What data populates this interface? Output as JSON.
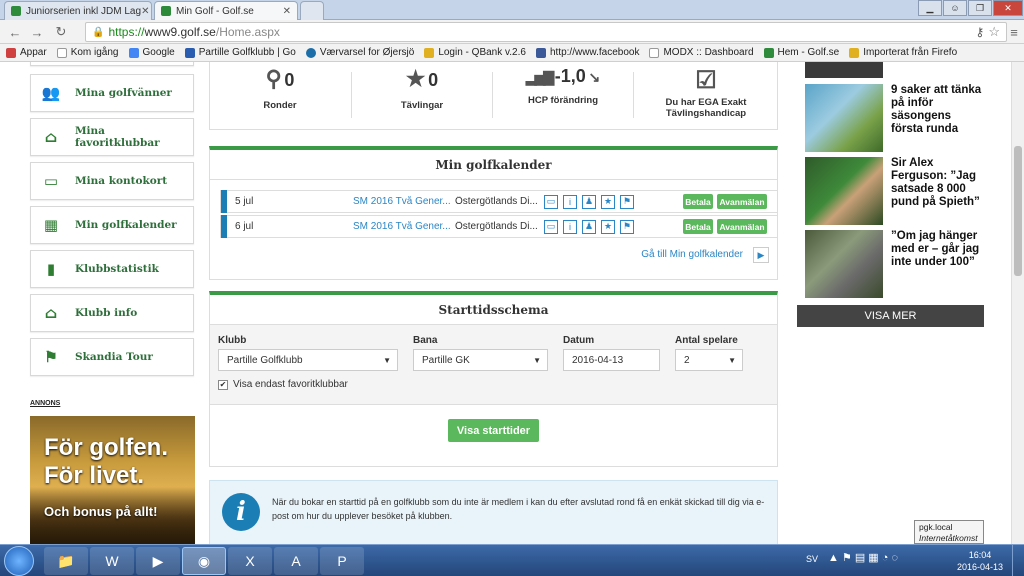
{
  "browser": {
    "tabs": [
      {
        "label": "Juniorserien inkl JDM Lag"
      },
      {
        "label": "Min Golf - Golf.se"
      }
    ],
    "url_https": "https://",
    "url_host": "www9.golf.se",
    "url_path": "/Home.aspx"
  },
  "bookmarks": [
    {
      "label": "Appar",
      "color": "#cc3333"
    },
    {
      "label": "Kom igång",
      "color": "#888888"
    },
    {
      "label": "Google",
      "color": "#4285f4"
    },
    {
      "label": "Partille Golfklubb | Go",
      "color": "#2a5db0"
    },
    {
      "label": "Værvarsel for Øjersjö",
      "color": "#1b6ea8"
    },
    {
      "label": "Login - QBank v.2.6",
      "color": "#e0b020"
    },
    {
      "label": "http://www.facebook",
      "color": "#3b5998"
    },
    {
      "label": "MODX :: Dashboard",
      "color": "#888888"
    },
    {
      "label": "Hem - Golf.se",
      "color": "#2e8b3c"
    },
    {
      "label": "Importerat från Firefo",
      "color": "#e0b020"
    }
  ],
  "sidebar": {
    "items": [
      {
        "label": "Mina golfvänner",
        "icon": "friends-icon",
        "glyph": "👥"
      },
      {
        "label": "Mina favoritklubbar",
        "icon": "clubhouse-icon",
        "glyph": "⌂"
      },
      {
        "label": "Mina kontokort",
        "icon": "card-icon",
        "glyph": "▭"
      },
      {
        "label": "Min golfkalender",
        "icon": "calendar-icon",
        "glyph": "▦"
      },
      {
        "label": "Klubbstatistik",
        "icon": "stats-icon",
        "glyph": "▮"
      },
      {
        "label": "Klubb info",
        "icon": "clubhouse-icon",
        "glyph": "⌂"
      },
      {
        "label": "Skandia Tour",
        "icon": "flag-icon",
        "glyph": "⚑"
      }
    ],
    "ad_label": "ANNONS",
    "ad_lines": [
      "För golfen.",
      "För livet.",
      "Och bonus på allt!"
    ]
  },
  "stats": [
    {
      "value": "0",
      "label": "Ronder",
      "icon": "golfer-icon",
      "glyph": "⚲"
    },
    {
      "value": "0",
      "label": "Tävlingar",
      "icon": "star-icon",
      "glyph": "★"
    },
    {
      "value": "-1,0",
      "label": "HCP förändring",
      "icon": "bar-chart-icon",
      "glyph": "▂▅▇",
      "trend": "↘"
    },
    {
      "value": "",
      "label": "Du har EGA Exakt Tävlingshandicap",
      "icon": "checkbox-icon",
      "glyph": "☑"
    }
  ],
  "calendar": {
    "title": "Min golfkalender",
    "rows": [
      {
        "date": "5 jul",
        "event": "SM 2016 Två Gener...",
        "location": "Östergötlands Di..."
      },
      {
        "date": "6 jul",
        "event": "SM 2016 Två Gener...",
        "location": "Östergötlands Di..."
      }
    ],
    "pay_label": "Betala",
    "unregister_label": "Avanmälan",
    "link_label": "Gå till Min golfkalender"
  },
  "teetimes": {
    "title": "Starttidsschema",
    "club_label": "Klubb",
    "club_value": "Partille Golfklubb",
    "course_label": "Bana",
    "course_value": "Partille GK",
    "date_label": "Datum",
    "date_value": "2016-04-13",
    "players_label": "Antal spelare",
    "players_value": "2",
    "favorites_label": "Visa endast favoritklubbar",
    "button_label": "Visa starttider"
  },
  "info": {
    "text": "När du bokar en starttid på en golfklubb som du inte är medlem i kan du efter avslutad rond få en enkät skickad till dig via e-post om hur du upplever besöket på klubben."
  },
  "news": [
    {
      "title": "9 saker att tänka på inför säsongens första runda"
    },
    {
      "title": "Sir Alex Ferguson: ”Jag satsade 8 000 pund på Spieth”"
    },
    {
      "title": "”Om jag hänger med er – går jag inte under 100”"
    }
  ],
  "show_more_label": "VISA MER",
  "tooltip": {
    "line1": "pgk.local",
    "line2": "Internetåtkomst"
  },
  "tray": {
    "lang": "SV",
    "time": "16:04",
    "date": "2016-04-13"
  }
}
